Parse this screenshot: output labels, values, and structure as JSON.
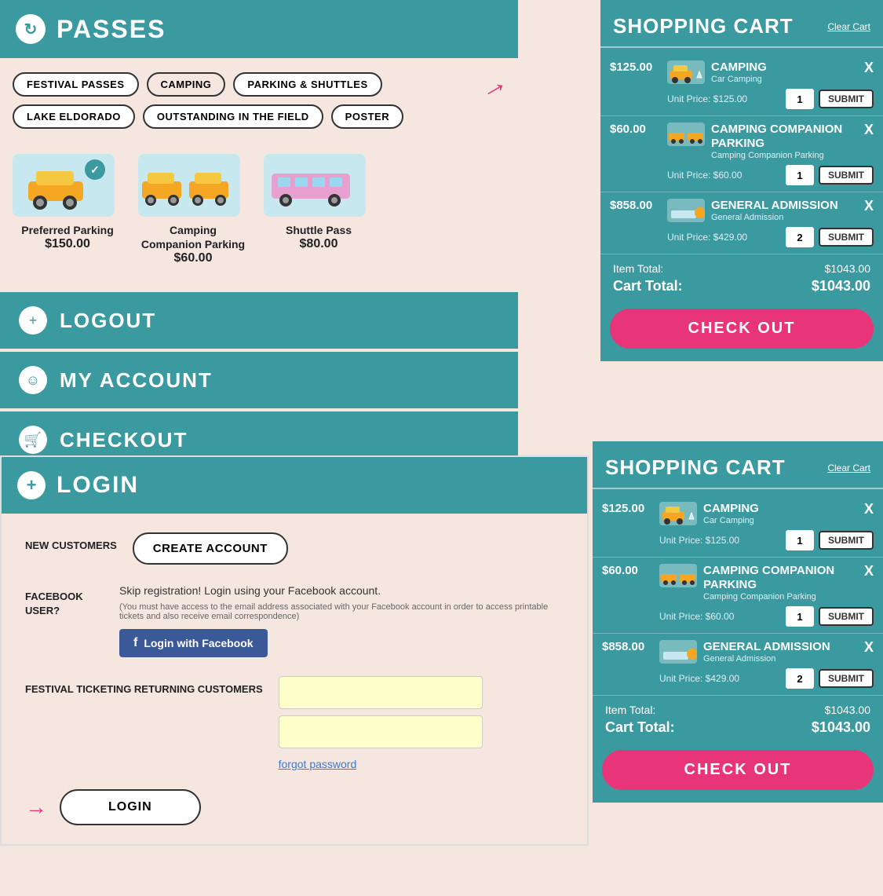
{
  "passes_section": {
    "header_icon": "↻",
    "title": "PASSES",
    "filters": [
      {
        "label": "FESTIVAL PASSES",
        "active": false
      },
      {
        "label": "CAMPING",
        "active": true
      },
      {
        "label": "PARKING & SHUTTLES",
        "active": false
      },
      {
        "label": "LAKE ELDORADO",
        "active": false
      },
      {
        "label": "OUTSTANDING IN THE FIELD",
        "active": false
      },
      {
        "label": "POSTER",
        "active": false
      }
    ],
    "products": [
      {
        "name": "Preferred Parking",
        "price": "$150.00"
      },
      {
        "name": "Camping Companion Parking",
        "price": "$60.00"
      },
      {
        "name": "Shuttle Pass",
        "price": "$80.00"
      }
    ]
  },
  "nav": {
    "logout": "LOGOUT",
    "my_account": "MY ACCOUNT",
    "checkout": "CHECKOUT"
  },
  "cart_top": {
    "title": "SHOPPING CART",
    "clear_cart": "Clear Cart",
    "items": [
      {
        "price": "$125.00",
        "title": "CAMPING",
        "subtitle": "Car Camping",
        "unit_price": "Unit Price: $125.00",
        "qty": "1"
      },
      {
        "price": "$60.00",
        "title": "CAMPING COMPANION PARKING",
        "subtitle": "Camping Companion Parking",
        "unit_price": "Unit Price: $60.00",
        "qty": "1"
      },
      {
        "price": "$858.00",
        "title": "GENERAL ADMISSION",
        "subtitle": "General Admission",
        "unit_price": "Unit Price: $429.00",
        "qty": "2"
      }
    ],
    "item_total_label": "Item Total:",
    "item_total_value": "$1043.00",
    "cart_total_label": "Cart Total:",
    "cart_total_value": "$1043.00",
    "checkout_btn": "CHECK OUT"
  },
  "login_section": {
    "title": "LOGIN",
    "new_customers_label": "NEW CUSTOMERS",
    "create_account_btn": "CREATE ACCOUNT",
    "facebook_label": "FACEBOOK USER?",
    "facebook_desc": "Skip registration! Login using your Facebook account.",
    "facebook_note": "(You must have access to the email address associated with your Facebook account in order to access printable tickets and also receive email correspondence)",
    "facebook_btn": "Login with Facebook",
    "returning_label": "FESTIVAL TICKETING RETURNING CUSTOMERS",
    "email_placeholder": "",
    "password_placeholder": "",
    "forgot_password": "forgot password",
    "login_btn": "LOGIN"
  },
  "cart_bottom": {
    "title": "SHOPPING CART",
    "clear_cart": "Clear Cart",
    "items": [
      {
        "price": "$125.00",
        "title": "CAMPING",
        "subtitle": "Car Camping",
        "unit_price": "Unit Price: $125.00",
        "qty": "1"
      },
      {
        "price": "$60.00",
        "title": "CAMPING COMPANION PARKING",
        "subtitle": "Camping Companion Parking",
        "unit_price": "Unit Price: $60.00",
        "qty": "1"
      },
      {
        "price": "$858.00",
        "title": "GENERAL ADMISSION",
        "subtitle": "General Admission",
        "unit_price": "Unit Price: $429.00",
        "qty": "2"
      }
    ],
    "item_total_label": "Item Total:",
    "item_total_value": "$1043.00",
    "cart_total_label": "Cart Total:",
    "cart_total_value": "$1043.00",
    "checkout_btn": "CHECK OUT"
  }
}
